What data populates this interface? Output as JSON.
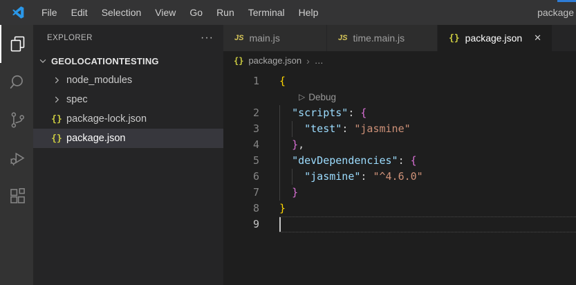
{
  "colors": {
    "accent_strip": "#2e7cd6",
    "titlebar_bg": "#343435",
    "activitybar_bg": "#333333",
    "sidebar_bg": "#252526",
    "editor_bg": "#1e1e1e",
    "tab_inactive_bg": "#2d2d2d",
    "list_selection_bg": "#37373d",
    "json_icon_yellow": "#cbcb41",
    "js_icon_yellow": "#d9c85a",
    "token_key_blue": "#9cdcfe",
    "token_string_orange": "#ce9178",
    "token_bracket_gold": "#ffd700",
    "token_bracket_pink": "#da70d6"
  },
  "titlebar": {
    "menu_items": [
      "File",
      "Edit",
      "Selection",
      "View",
      "Go",
      "Run",
      "Terminal",
      "Help"
    ],
    "window_title": "package"
  },
  "activity_bar": {
    "items": [
      {
        "icon": "files",
        "active": true
      },
      {
        "icon": "search",
        "active": false
      },
      {
        "icon": "source-control",
        "active": false
      },
      {
        "icon": "run-debug",
        "active": false
      },
      {
        "icon": "extensions",
        "active": false
      }
    ]
  },
  "sidebar": {
    "header": "EXPLORER",
    "more_label": "···",
    "root": {
      "label": "GEOLOCATIONTESTING",
      "expanded": true
    },
    "items": [
      {
        "label": "node_modules",
        "kind": "folder",
        "selected": false
      },
      {
        "label": "spec",
        "kind": "folder",
        "selected": false
      },
      {
        "label": "package-lock.json",
        "kind": "json",
        "selected": false
      },
      {
        "label": "package.json",
        "kind": "json",
        "selected": true
      }
    ]
  },
  "tabs": [
    {
      "label": "main.js",
      "icon": "js",
      "active": false
    },
    {
      "label": "time.main.js",
      "icon": "js",
      "active": false
    },
    {
      "label": "package.json",
      "icon": "json",
      "active": true,
      "close_label": "✕"
    }
  ],
  "breadcrumb": {
    "file": "package.json",
    "separator": "›",
    "more": "…"
  },
  "editor": {
    "codelens": {
      "play": "▷",
      "label": "Debug"
    },
    "json_glyph": "{}",
    "js_glyph": "JS",
    "lines": [
      {
        "num": "1",
        "segments": [
          {
            "t": "{",
            "c": "b1"
          }
        ]
      },
      {
        "lens": true
      },
      {
        "num": "2",
        "segments": [
          {
            "t": "  "
          },
          {
            "t": "\"scripts\"",
            "c": "k"
          },
          {
            "t": ": "
          },
          {
            "t": "{",
            "c": "b2"
          }
        ]
      },
      {
        "num": "3",
        "segments": [
          {
            "t": "    "
          },
          {
            "t": "\"test\"",
            "c": "k"
          },
          {
            "t": ": "
          },
          {
            "t": "\"jasmine\"",
            "c": "s"
          }
        ]
      },
      {
        "num": "4",
        "segments": [
          {
            "t": "  "
          },
          {
            "t": "}",
            "c": "b2"
          },
          {
            "t": ","
          }
        ]
      },
      {
        "num": "5",
        "segments": [
          {
            "t": "  "
          },
          {
            "t": "\"devDependencies\"",
            "c": "k"
          },
          {
            "t": ": "
          },
          {
            "t": "{",
            "c": "b2"
          }
        ]
      },
      {
        "num": "6",
        "segments": [
          {
            "t": "    "
          },
          {
            "t": "\"jasmine\"",
            "c": "k"
          },
          {
            "t": ": "
          },
          {
            "t": "\"^4.6.0\"",
            "c": "s"
          }
        ]
      },
      {
        "num": "7",
        "segments": [
          {
            "t": "  "
          },
          {
            "t": "}",
            "c": "b2"
          }
        ]
      },
      {
        "num": "8",
        "segments": [
          {
            "t": "}",
            "c": "b1"
          }
        ]
      },
      {
        "num": "9",
        "segments": [],
        "current": true,
        "cursor": true
      }
    ]
  }
}
